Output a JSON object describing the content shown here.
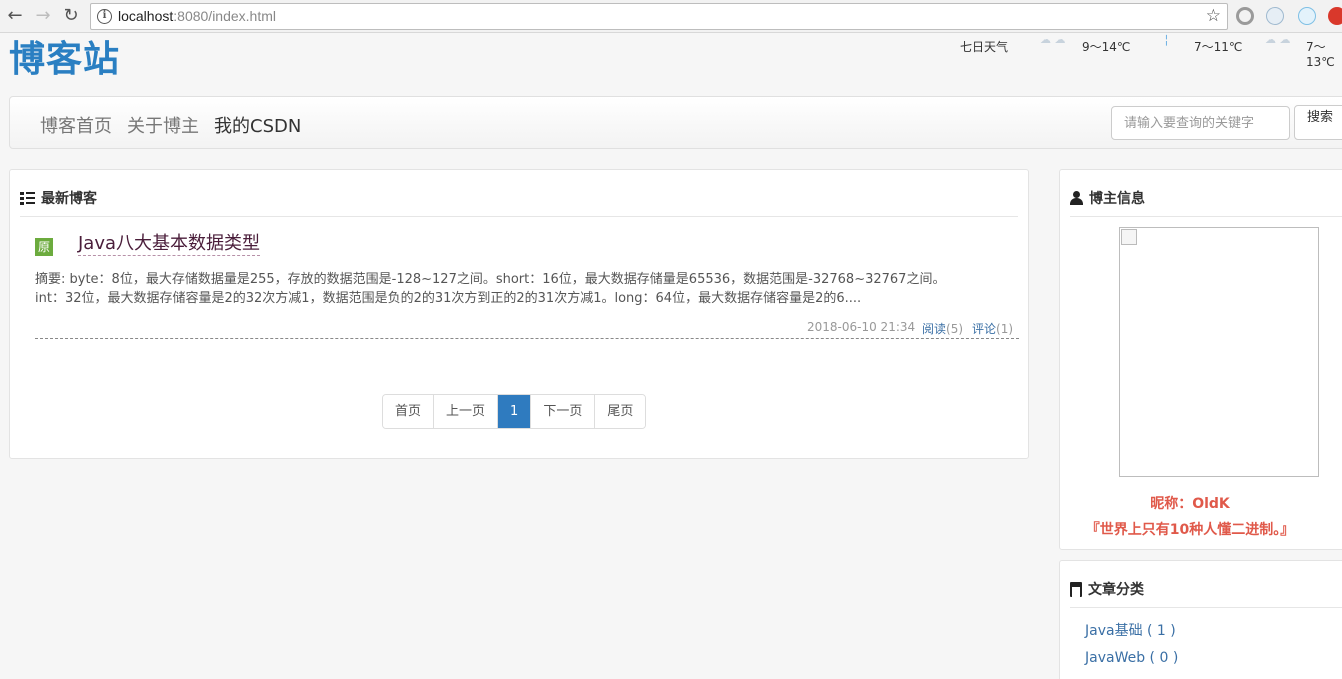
{
  "browser": {
    "url_host": "localhost",
    "url_rest": ":8080/index.html",
    "back_icon": "back-arrow-icon",
    "forward_icon": "forward-arrow-icon",
    "reload_icon": "reload-icon",
    "bookmark_icon": "star-icon"
  },
  "header": {
    "logo": "博客站",
    "weather_label": "七日天气",
    "weather": [
      {
        "temp": "9～14℃"
      },
      {
        "temp": "7～11℃"
      },
      {
        "temp": "7～13℃"
      }
    ]
  },
  "navbar": {
    "links": [
      "博客首页",
      "关于博主",
      "我的CSDN"
    ],
    "search_placeholder": "请输入要查询的关键字",
    "search_button": "搜索"
  },
  "main": {
    "title": "最新博客",
    "posts": [
      {
        "badge": "原",
        "title": "Java八大基本数据类型",
        "summary_line1": "摘要: byte：8位，最大存储数据量是255，存放的数据范围是-128~127之间。short：16位，最大数据存储量是65536，数据范围是-32768~32767之间。",
        "summary_line2": "int：32位，最大数据存储容量是2的32次方减1，数据范围是负的2的31次方到正的2的31次方减1。long：64位，最大数据存储容量是2的6....",
        "date": "2018-06-10 21:34",
        "read_label": "阅读",
        "read_count": "(5)",
        "comment_label": "评论",
        "comment_count": "(1)"
      }
    ],
    "pagination": [
      "首页",
      "上一页",
      "1",
      "下一页",
      "尾页"
    ]
  },
  "sidebar": {
    "blogger_title": "博主信息",
    "nickname": "昵称：OldK",
    "motto": "『世界上只有10种人懂二进制。』",
    "category_title": "文章分类",
    "categories": [
      "Java基础 ( 1 )",
      "JavaWeb ( 0 )"
    ]
  },
  "colors": {
    "brand": "#2a7fc2",
    "accent_red": "#e0594a",
    "link": "#3a6fa5",
    "badge_green": "#6cab3e"
  }
}
